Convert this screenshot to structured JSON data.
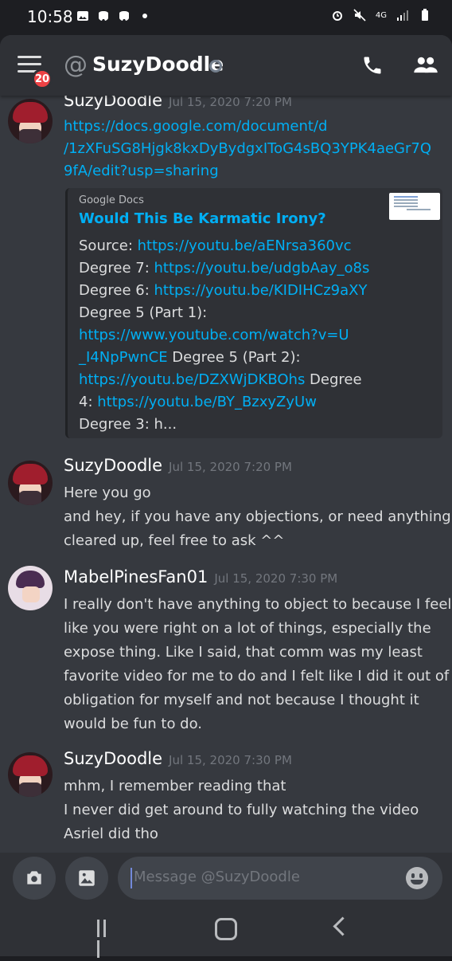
{
  "status_bar": {
    "time": "10:58",
    "network": "4G"
  },
  "header": {
    "notification_count": "20",
    "at_symbol": "@",
    "title": "SuzyDoodle"
  },
  "messages": [
    {
      "author": "SuzyDoodle",
      "timestamp": "Jul 15, 2020 7:20 PM",
      "lines": [
        "https://docs.google.com/document/d",
        "/1zXFuSG8Hjgk8kxDyBydgxIToG4sBQ3YPK4aeGr7Q",
        "9fA/edit?usp=sharing"
      ],
      "embed": {
        "provider": "Google Docs",
        "title": "Would This Be Karmatic Irony?",
        "rows": [
          {
            "text": "Source: ",
            "link": "https://youtu.be/aENrsa360vc",
            "after": ""
          },
          {
            "text": "Degree 7: ",
            "link": "https://youtu.be/udgbAay_o8s",
            "after": ""
          },
          {
            "text": "Degree 6: ",
            "link": "https://youtu.be/KIDIHCz9aXY",
            "after": ""
          },
          {
            "text": "Degree 5 (Part 1):",
            "link": "",
            "after": ""
          },
          {
            "text": "",
            "link": "https://www.youtube.com/watch?v=U",
            "after": ""
          },
          {
            "text": "",
            "link": "_I4NpPwnCE",
            "after": " Degree 5 (Part 2):"
          },
          {
            "text": "",
            "link": "https://youtu.be/DZXWjDKBOhs",
            "after": " Degree"
          },
          {
            "text": "4: ",
            "link": "https://youtu.be/BY_BzxyZyUw",
            "after": ""
          },
          {
            "text": "Degree 3: h...",
            "link": "",
            "after": ""
          }
        ]
      }
    },
    {
      "author": "SuzyDoodle",
      "timestamp": "Jul 15, 2020 7:20 PM",
      "lines": [
        "Here you go",
        "and hey, if you have any objections, or need anything",
        "cleared up, feel free to ask ^^"
      ]
    },
    {
      "author": "MabelPinesFan01",
      "timestamp": "Jul 15, 2020 7:30 PM",
      "lines": [
        "I really don't have anything to object to because I feel",
        "like you were right on a lot of things, especially the",
        "expose thing. Like I said, that comm was my least",
        "favorite video for me to do and I felt like I did it out of",
        "obligation for myself and not because I thought it",
        "would be fun to do."
      ]
    },
    {
      "author": "SuzyDoodle",
      "timestamp": "Jul 15, 2020 7:30 PM",
      "lines": [
        "mhm, I remember reading that",
        "I never did get around to fully watching the video",
        "Asriel did tho"
      ]
    }
  ],
  "composer": {
    "placeholder": "Message @SuzyDoodle"
  },
  "colors": {
    "link": "#00aff4",
    "badge": "#ed4245",
    "background": "#36393f"
  },
  "icons": [
    "gallery-icon",
    "discord-icon",
    "alarm-icon",
    "mute-icon",
    "signal-icon",
    "battery-icon",
    "menu-icon",
    "phone-icon",
    "members-icon",
    "camera-icon",
    "image-icon",
    "emoji-icon",
    "recent-apps-icon",
    "home-icon",
    "back-icon"
  ]
}
